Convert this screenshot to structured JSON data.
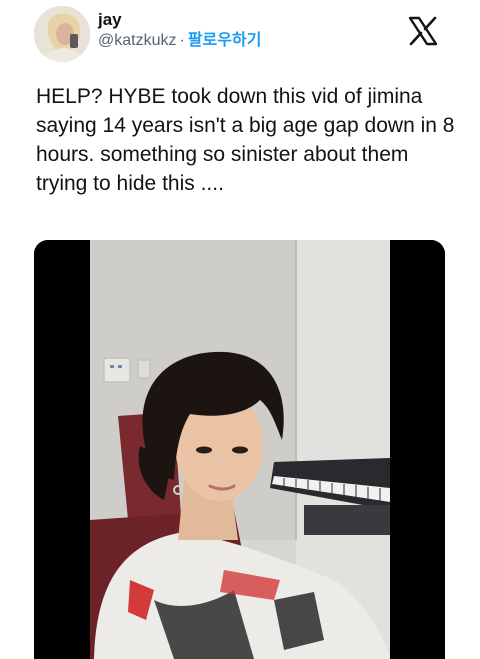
{
  "user": {
    "display_name": "jay",
    "handle": "@katzkukz",
    "separator": "·",
    "follow_label": "팔로우하기"
  },
  "tweet": {
    "text": "HELP? HYBE took down this vid of jimina saying 14 years isn't a big age gap down in 8 hours. something so sinister about them trying to hide this ...."
  },
  "icons": {
    "platform": "x-logo-icon",
    "avatar": "avatar-photo"
  },
  "media": {
    "type": "video-still",
    "description_visible": false
  },
  "colors": {
    "follow": "#1d9bf0",
    "handle": "#536471",
    "text": "#0f1419"
  }
}
